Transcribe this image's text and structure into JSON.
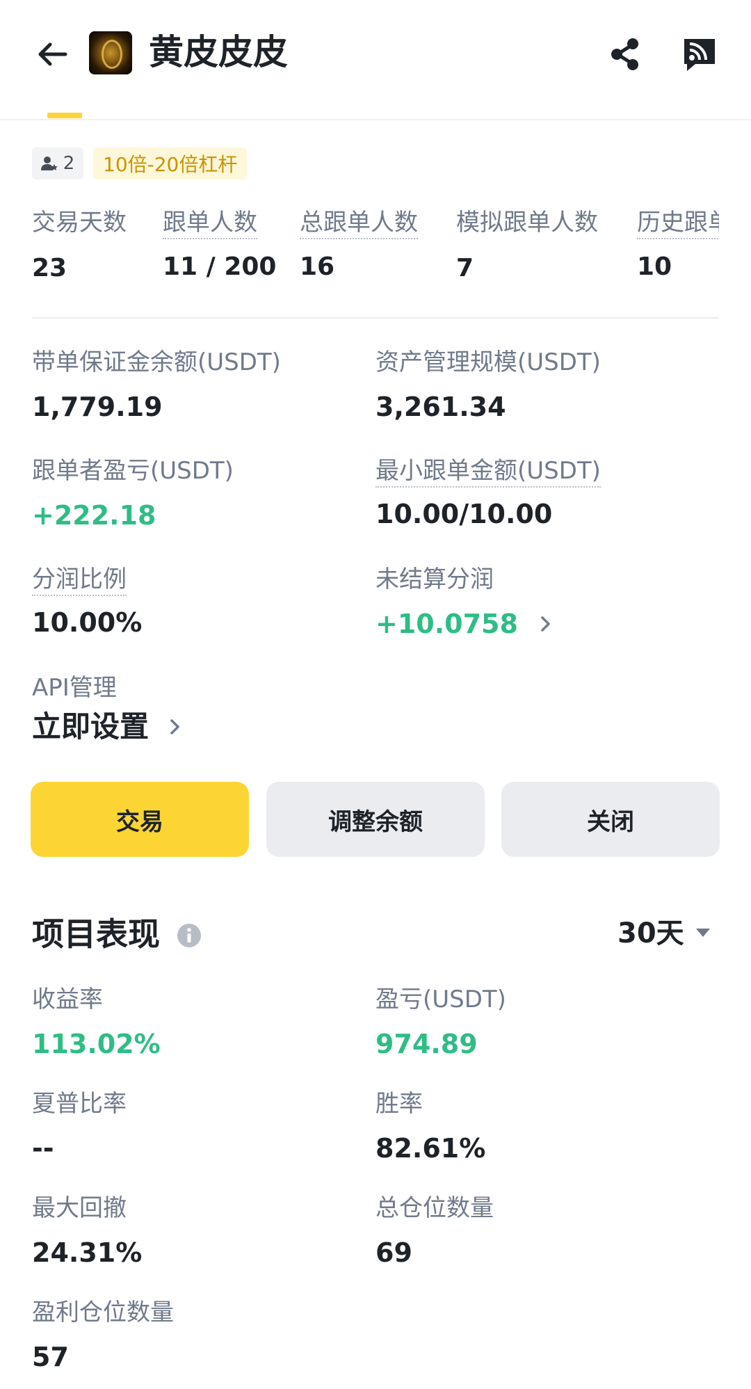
{
  "header": {
    "title": "黄皮皮皮",
    "back_icon": "arrow-left-icon",
    "share_icon": "share-icon",
    "feed_icon": "feed-icon"
  },
  "tags": {
    "follower_count": "2",
    "leverage": "10倍-20倍杠杆"
  },
  "stats": [
    {
      "label": "交易天数",
      "value": "23"
    },
    {
      "label": "跟单人数",
      "value": "11 / 200"
    },
    {
      "label": "总跟单人数",
      "value": "16"
    },
    {
      "label": "模拟跟单人数",
      "value": "7"
    },
    {
      "label": "历史跟单",
      "value": "10"
    }
  ],
  "details": {
    "margin_balance": {
      "label": "带单保证金余额(USDT)",
      "value": "1,779.19"
    },
    "aum": {
      "label": "资产管理规模(USDT)",
      "value": "3,261.34"
    },
    "follower_pnl": {
      "label": "跟单者盈亏(USDT)",
      "value": "+222.18"
    },
    "min_copy": {
      "label": "最小跟单金额(USDT)",
      "value": "10.00/10.00"
    },
    "profit_share": {
      "label": "分润比例",
      "value": "10.00%"
    },
    "unsettled": {
      "label": "未结算分润",
      "value": "+10.0758"
    },
    "api": {
      "label": "API管理",
      "value": "立即设置"
    }
  },
  "buttons": {
    "trade": "交易",
    "adjust": "调整余额",
    "close": "关闭"
  },
  "performance": {
    "title": "项目表现",
    "period": "30天",
    "metrics": {
      "roi": {
        "label": "收益率",
        "value": "113.02%"
      },
      "pnl": {
        "label": "盈亏(USDT)",
        "value": "974.89"
      },
      "sharpe": {
        "label": "夏普比率",
        "value": "--"
      },
      "win_rate": {
        "label": "胜率",
        "value": "82.61%"
      },
      "max_drawdown": {
        "label": "最大回撤",
        "value": "24.31%"
      },
      "total_positions": {
        "label": "总仓位数量",
        "value": "69"
      },
      "profit_positions": {
        "label": "盈利仓位数量",
        "value": "57"
      }
    }
  },
  "colors": {
    "accent": "#fcd535",
    "positive": "#2ebd85",
    "muted": "#707a8a",
    "text": "#1e2329"
  }
}
